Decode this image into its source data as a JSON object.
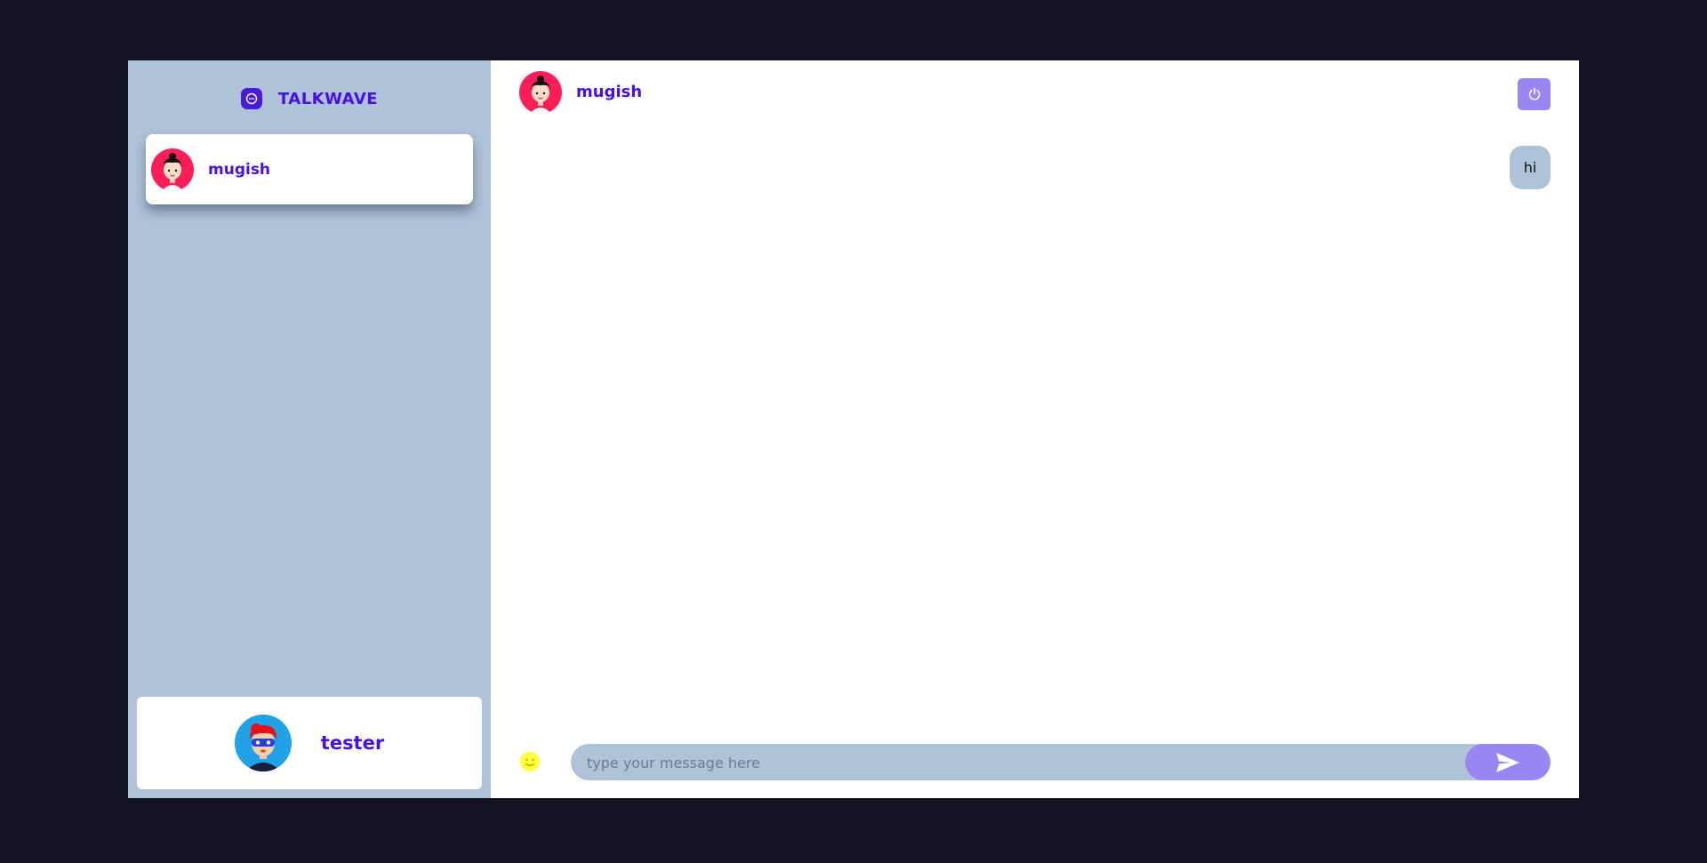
{
  "brand": {
    "name": "TALKWAVE",
    "icon": "chat-bubble-icon"
  },
  "contacts": [
    {
      "name": "mugish",
      "avatar": "girl-avatar",
      "selected": true
    }
  ],
  "current_user": {
    "name": "tester",
    "avatar": "masked-hero-avatar"
  },
  "chat": {
    "contact_name": "mugish",
    "logout_icon": "power-icon",
    "messages": [
      {
        "text": "hi",
        "sent": true
      }
    ],
    "input_placeholder": "type your message here",
    "input_value": "",
    "emoji_icon": "smiley-icon",
    "send_icon": "send-icon"
  },
  "colors": {
    "background": "#131324",
    "sidebar": "#aec2d8",
    "accent": "#4a0fe6",
    "button": "#9a86f3",
    "emoji": "#ffff00c8"
  }
}
